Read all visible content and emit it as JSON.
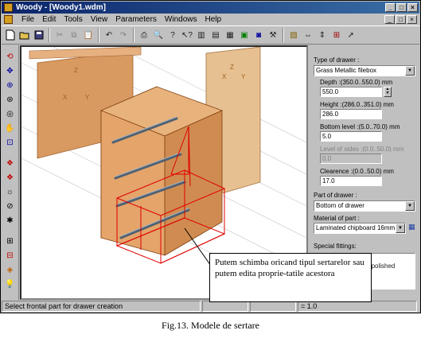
{
  "window": {
    "title": "Woody - [Woody1.wdm]",
    "controls": [
      "_",
      "□",
      "×"
    ]
  },
  "menubar": {
    "items": [
      "File",
      "Edit",
      "Tools",
      "View",
      "Parameters",
      "Windows",
      "Help"
    ]
  },
  "toolbar": {
    "icons": [
      "new-icon",
      "open-icon",
      "save-icon",
      "cut-icon",
      "copy-icon",
      "paste-icon",
      "undo-icon",
      "redo-icon",
      "print-icon",
      "print-preview-icon",
      "help-icon",
      "context-help-icon",
      "tool-icon",
      "tool-icon",
      "tool-icon",
      "tool-icon",
      "tool-icon",
      "tool-icon",
      "tool-icon",
      "tool-icon",
      "tool-icon",
      "tool-icon",
      "tool-icon"
    ]
  },
  "viewport": {
    "axis_labels": [
      "Z",
      "X",
      "Y",
      "X",
      "Z",
      "Y"
    ]
  },
  "rightpanel": {
    "type_of_drawer_label": "Type of drawer :",
    "type_of_drawer_value": "Grass Metallic filebox",
    "depth_label": "Depth :(350.0..550.0) mm",
    "depth_value": "550.0",
    "height_label": "Height :(286.0..351.0) mm",
    "height_value": "286.0",
    "bottom_level_label": "Bottom level :(5.0..70.0) mm",
    "bottom_level_value": "5.0",
    "level_of_sides_label": "Level of sides :(0.0..50.0) mm",
    "level_of_sides_value": "0.0",
    "clearence_label": "Clearence :(0.0..50.0) mm",
    "clearence_value": "17.0",
    "part_of_drawer_label": "Part of drawer :",
    "part_of_drawer_value": "Bottom of drawer",
    "material_label": "Material of part :",
    "material_value": "Laminated chipboard 16mm.",
    "special_fittings_label": "Special fittings:",
    "special_fittings_items": [
      "y",
      "ond/polished"
    ]
  },
  "statusbar": {
    "message": "Select frontal part for drawer creation",
    "coord1": "",
    "coord2": "",
    "zoom": "= 1.0"
  },
  "callout": {
    "text": "Putem schimba oricand tipul sertarelor sau putem edita proprie-tatile acestora"
  },
  "caption": {
    "text": "Fig.13. Modele de sertare"
  }
}
